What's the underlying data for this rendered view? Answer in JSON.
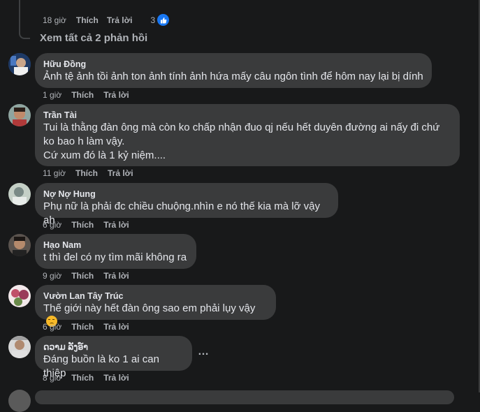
{
  "top": {
    "time": "18 giờ",
    "like": "Thích",
    "reply": "Trả lời",
    "reaction_count": "3",
    "view_replies": "Xem tất cả 2 phản hồi"
  },
  "comments": [
    {
      "author": "Hữu Đồng",
      "text": "Ảnh tệ ảnh tồi ảnh ton ảnh tính ảnh hứa mấy câu ngôn tình để hôm nay lại bị dính",
      "time": "1 giờ",
      "like": "Thích",
      "reply": "Trả lời",
      "avatar_color": "#2d4a7a"
    },
    {
      "author": "Trần Tài",
      "text": "Tui là thằng đàn ông mà còn ko chấp nhận đuo qj nếu hết duyên đường ai nấy đi chứ ko bao h làm vậy.\nCứ xum đó là 1 kỷ niệm....",
      "time": "11 giờ",
      "like": "Thích",
      "reply": "Trả lời",
      "avatar_color": "#7a5a44"
    },
    {
      "author": "Nợ Nợ Hung",
      "text": "Phụ nữ là phải đc chiều chuộng.nhìn e nó thế kia mà lỡ vậy ah",
      "time": "6 giờ",
      "like": "Thích",
      "reply": "Trả lời",
      "avatar_color": "#b7c4b8"
    },
    {
      "author": "Hạo Nam",
      "text": "t thì đel có ny tìm mãi không ra",
      "time": "9 giờ",
      "like": "Thích",
      "reply": "Trả lời",
      "avatar_color": "#3b3633"
    },
    {
      "author": "Vườn Lan Tây Trúc",
      "text": "Thế giới này hết đàn ông sao em phải lụy vậy",
      "time": "6 giờ",
      "like": "Thích",
      "reply": "Trả lời",
      "avatar_color": "#8a4a5a"
    },
    {
      "author": "ດວາມ ລັງອ໌າ",
      "text": "Đáng buồn là ko 1 ai can thiệp",
      "time": "8 giờ",
      "like": "Thích",
      "reply": "Trả lời",
      "more": "…",
      "avatar_color": "#9a9a9a"
    }
  ]
}
